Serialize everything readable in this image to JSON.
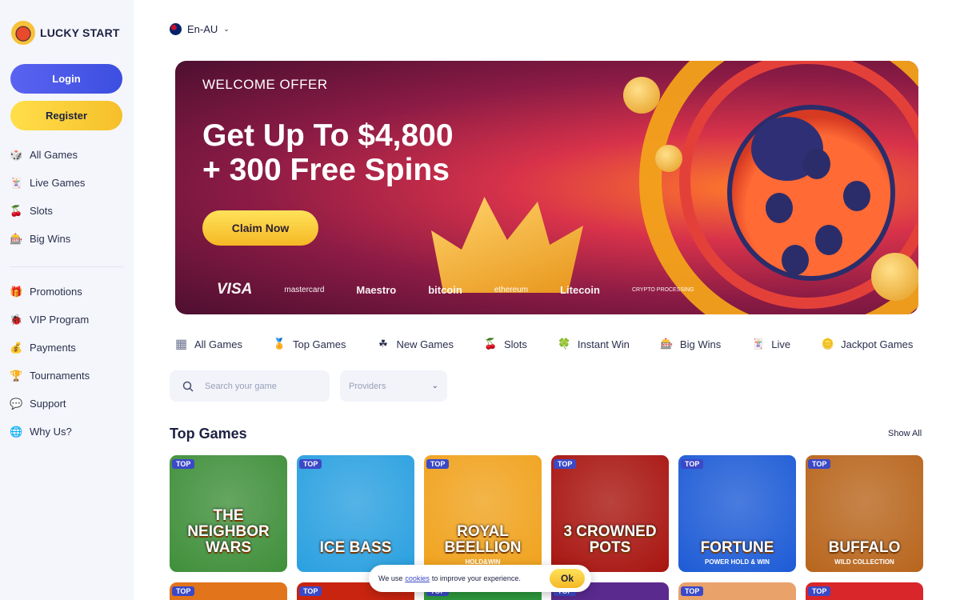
{
  "brand": {
    "name": "LUCKY START"
  },
  "auth": {
    "login_label": "Login",
    "register_label": "Register"
  },
  "sidebar": {
    "primary": [
      {
        "label": "All Games",
        "icon": "dice-icon"
      },
      {
        "label": "Live Games",
        "icon": "live-cards-icon"
      },
      {
        "label": "Slots",
        "icon": "cherries-icon"
      },
      {
        "label": "Big Wins",
        "icon": "slot-machine-icon"
      }
    ],
    "secondary": [
      {
        "label": "Promotions",
        "icon": "gift-icon"
      },
      {
        "label": "VIP Program",
        "icon": "ladybug-icon"
      },
      {
        "label": "Payments",
        "icon": "money-bag-icon"
      },
      {
        "label": "Tournaments",
        "icon": "trophy-icon"
      },
      {
        "label": "Support",
        "icon": "chat-icon"
      },
      {
        "label": "Why Us?",
        "icon": "globe-icon"
      }
    ]
  },
  "language": {
    "label": "En-AU"
  },
  "banner": {
    "kicker": "WELCOME OFFER",
    "headline_line1": "Get Up To $4,800",
    "headline_line2": "+ 300 Free Spins",
    "cta": "Claim Now",
    "payments": [
      "VISA",
      "mastercard",
      "Maestro",
      "bitcoin",
      "ethereum",
      "Litecoin",
      "CRYPTO PROCESSING"
    ]
  },
  "categories": [
    {
      "label": "All Games",
      "icon": "grid-icon"
    },
    {
      "label": "Top Games",
      "icon": "medal-icon"
    },
    {
      "label": "New Games",
      "icon": "clover-icon"
    },
    {
      "label": "Slots",
      "icon": "cherries-icon"
    },
    {
      "label": "Instant Win",
      "icon": "four-leaf-icon"
    },
    {
      "label": "Big Wins",
      "icon": "slot-machine-icon"
    },
    {
      "label": "Live",
      "icon": "live-cards-icon"
    },
    {
      "label": "Jackpot Games",
      "icon": "coin-icon"
    }
  ],
  "search": {
    "placeholder": "Search your game",
    "providers_label": "Providers"
  },
  "top_games": {
    "title": "Top Games",
    "show_all": "Show All",
    "badge": "TOP",
    "games": [
      {
        "name": "THE NEIGHBOR WARS",
        "sub": "",
        "color": "#3f8f3a"
      },
      {
        "name": "ICE BASS",
        "sub": "",
        "color": "#2aa0e0"
      },
      {
        "name": "ROYAL BEELLION",
        "sub": "HOLD&WIN",
        "color": "#f0a21c"
      },
      {
        "name": "3 CROWNED POTS",
        "sub": "",
        "color": "#a8140f"
      },
      {
        "name": "FORTUNE",
        "sub": "POWER HOLD & WIN",
        "color": "#1d5bd6"
      },
      {
        "name": "BUFFALO",
        "sub": "WILD COLLECTION",
        "color": "#b8651c"
      }
    ],
    "row2_colors": [
      "#e2741c",
      "#c8240f",
      "#2e9a3f",
      "#5a2a8f",
      "#e9a26a",
      "#d8262a"
    ]
  },
  "cookie": {
    "prefix": "We use",
    "link": "cookies",
    "suffix": "to improve your experience.",
    "ok": "Ok"
  }
}
